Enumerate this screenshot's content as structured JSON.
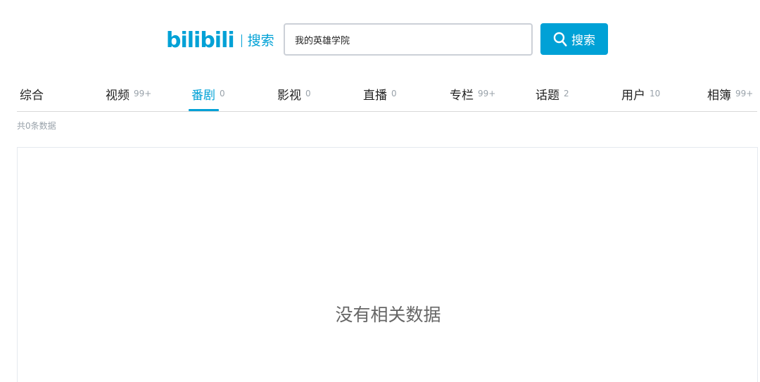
{
  "logo": {
    "brand": "bilibili",
    "section": "搜索"
  },
  "search": {
    "value": "我的英雄学院",
    "button_label": "搜索"
  },
  "tabs": [
    {
      "name": "综合",
      "count": ""
    },
    {
      "name": "视频",
      "count": "99+"
    },
    {
      "name": "番剧",
      "count": "0"
    },
    {
      "name": "影视",
      "count": "0"
    },
    {
      "name": "直播",
      "count": "0"
    },
    {
      "name": "专栏",
      "count": "99+"
    },
    {
      "name": "话题",
      "count": "2"
    },
    {
      "name": "用户",
      "count": "10"
    },
    {
      "name": "相簿",
      "count": "99+"
    }
  ],
  "active_tab": "番剧",
  "total_text": "共0条数据",
  "empty_text": "没有相关数据",
  "colors": {
    "accent": "#00a1d6",
    "muted": "#99a2aa",
    "border": "#ccd0d7"
  },
  "icons": {
    "search_button": "search-icon"
  }
}
